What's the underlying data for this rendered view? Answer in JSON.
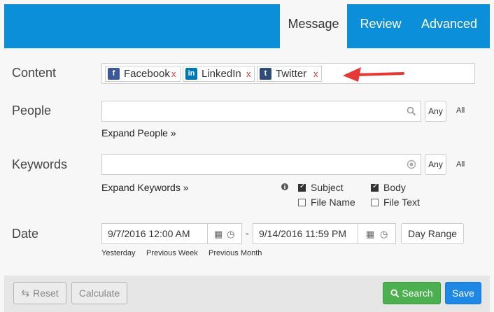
{
  "header": {
    "tabs": [
      {
        "label": "Message"
      },
      {
        "label": "Review"
      },
      {
        "label": "Advanced"
      }
    ]
  },
  "content": {
    "label": "Content",
    "chips": [
      {
        "label": "Facebook",
        "icon": "facebook-icon",
        "remove": "x",
        "color": "#3b5998"
      },
      {
        "label": "LinkedIn",
        "icon": "linkedin-icon",
        "remove": "x",
        "color": "#0077b5"
      },
      {
        "label": "Twitter",
        "icon": "twitter-icon",
        "remove": "x",
        "color": "#2e4b7a"
      }
    ]
  },
  "people": {
    "label": "People",
    "any": "Any",
    "all": "All",
    "expand": "Expand People »"
  },
  "keywords": {
    "label": "Keywords",
    "any": "Any",
    "all": "All",
    "expand": "Expand Keywords »",
    "options": [
      {
        "label": "Subject",
        "checked": true
      },
      {
        "label": "Body",
        "checked": true
      },
      {
        "label": "File Name",
        "checked": false
      },
      {
        "label": "File Text",
        "checked": false
      }
    ]
  },
  "date": {
    "label": "Date",
    "from": "9/7/2016 12:00 AM",
    "separator": "-",
    "to": "9/14/2016 11:59 PM",
    "range_button": "Day Range",
    "quick": [
      "Yesterday",
      "Previous Week",
      "Previous Month"
    ]
  },
  "footer": {
    "reset": "Reset",
    "calculate": "Calculate",
    "search": "Search",
    "save": "Save"
  },
  "colors": {
    "header": "#0a8fd8",
    "search": "#4caf50",
    "save": "#1e88e5",
    "arrow": "#e53935"
  }
}
